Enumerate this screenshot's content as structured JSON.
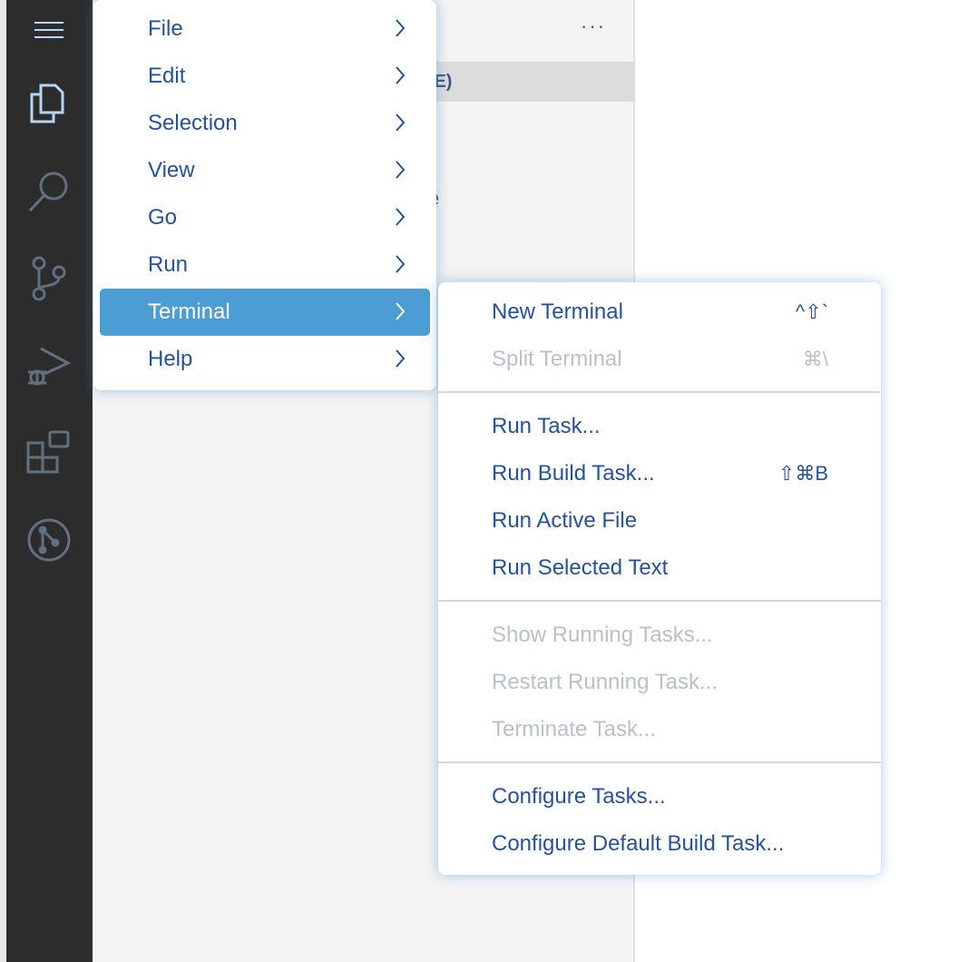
{
  "sidebar": {
    "header_fragment": "CE)",
    "text_fragment": "e",
    "more_label": "···"
  },
  "menu": {
    "items": [
      {
        "label": "File"
      },
      {
        "label": "Edit"
      },
      {
        "label": "Selection"
      },
      {
        "label": "View"
      },
      {
        "label": "Go"
      },
      {
        "label": "Run"
      },
      {
        "label": "Terminal",
        "selected": true
      },
      {
        "label": "Help"
      }
    ]
  },
  "submenu": {
    "groups": [
      [
        {
          "label": "New Terminal",
          "shortcut": "^⇧`",
          "enabled": true
        },
        {
          "label": "Split Terminal",
          "shortcut": "⌘\\",
          "enabled": false
        }
      ],
      [
        {
          "label": "Run Task...",
          "enabled": true
        },
        {
          "label": "Run Build Task...",
          "shortcut": "⇧⌘B",
          "enabled": true
        },
        {
          "label": "Run Active File",
          "enabled": true
        },
        {
          "label": "Run Selected Text",
          "enabled": true
        }
      ],
      [
        {
          "label": "Show Running Tasks...",
          "enabled": false
        },
        {
          "label": "Restart Running Task...",
          "enabled": false
        },
        {
          "label": "Terminate Task...",
          "enabled": false
        }
      ],
      [
        {
          "label": "Configure Tasks...",
          "enabled": true
        },
        {
          "label": "Configure Default Build Task...",
          "enabled": true
        }
      ]
    ]
  },
  "colors": {
    "accent": "#4c9dd3",
    "text": "#23539f",
    "disabled": "#b9c0cc",
    "activity_bar": "#2c2c2c"
  }
}
